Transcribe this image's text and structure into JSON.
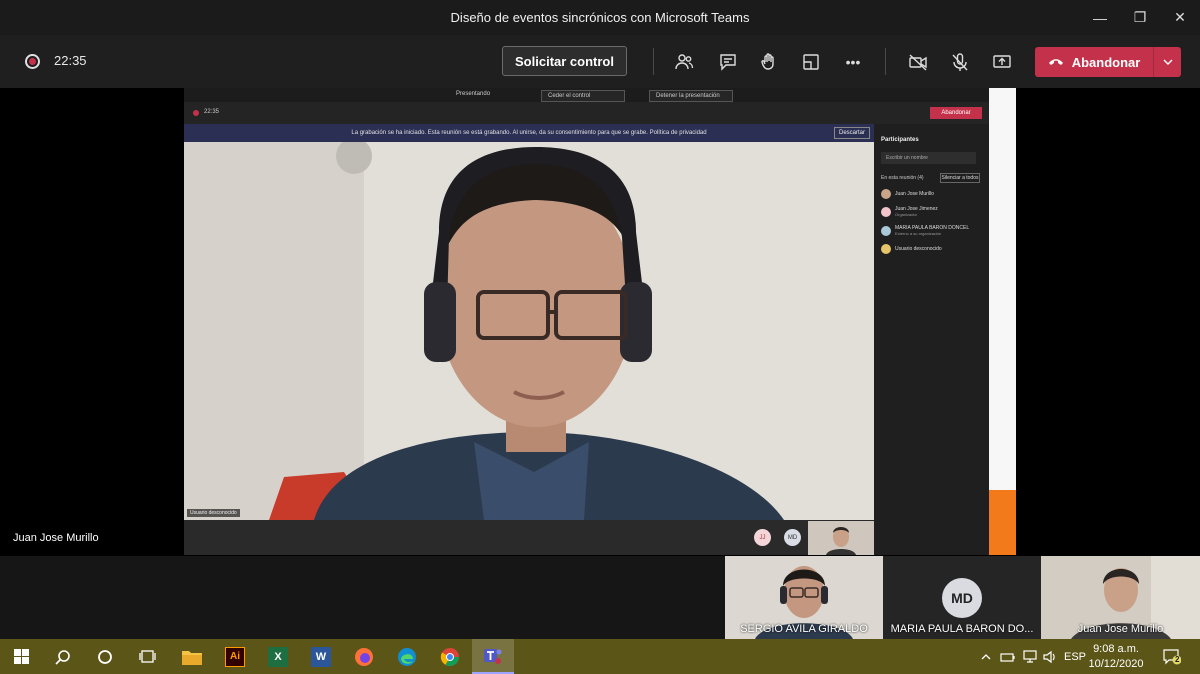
{
  "window": {
    "title": "Diseño de eventos sincrónicos con Microsoft Teams",
    "minimize": "—",
    "restore": "❐",
    "close": "✕"
  },
  "toolbar": {
    "timer": "22:35",
    "request_control": "Solicitar control",
    "more": "•••",
    "leave": "Abandonar",
    "leave_color": "#c4314b"
  },
  "stage": {
    "presenter_name": "Juan Jose Murillo"
  },
  "shared_screen": {
    "presenting_label": "Presentando",
    "give_control": "Ceder el control",
    "stop_presenting": "Detener la presentación",
    "inner_timer": "22:35",
    "inner_leave": "Abandonar",
    "banner": "La grabación se ha iniciado. Esta reunión se está grabando. Al unirse, da su consentimiento para que se grabe. Política de privacidad",
    "banner_dismiss": "Descartar",
    "video_label": "Usuario desconocido",
    "panel": {
      "title": "Participantes",
      "search_placeholder": "Escribir un nombre",
      "section": "En esta reunión (4)",
      "mute_all": "Silenciar a todos",
      "participants": [
        {
          "name": "Juan Jose Murillo",
          "sub": ""
        },
        {
          "name": "Juan Jose Jimenez",
          "sub": "Organizador"
        },
        {
          "name": "MARIA PAULA BARON DONCEL",
          "sub": "Externo a su organización"
        },
        {
          "name": "Usuario desconocido",
          "sub": ""
        }
      ]
    },
    "bubbles": [
      "JJ",
      "MD"
    ]
  },
  "tiles": [
    {
      "name": "SERGIO AVILA GIRALDO",
      "type": "video"
    },
    {
      "name": "MARIA PAULA BARON DO...",
      "type": "avatar",
      "initials": "MD"
    },
    {
      "name": "Juan Jose Murillo",
      "type": "video"
    }
  ],
  "taskbar": {
    "apps": [
      "start-icon",
      "search-icon",
      "cortana-icon",
      "task-view-icon",
      "file-explorer-icon",
      "illustrator-icon",
      "excel-icon",
      "word-icon",
      "firefox-icon",
      "edge-icon",
      "chrome-icon",
      "teams-icon"
    ],
    "illustrator_label": "Ai",
    "excel_label": "X",
    "word_label": "W",
    "language": "ESP",
    "time": "9:08 a.m.",
    "date": "10/12/2020",
    "notifications": "2"
  }
}
